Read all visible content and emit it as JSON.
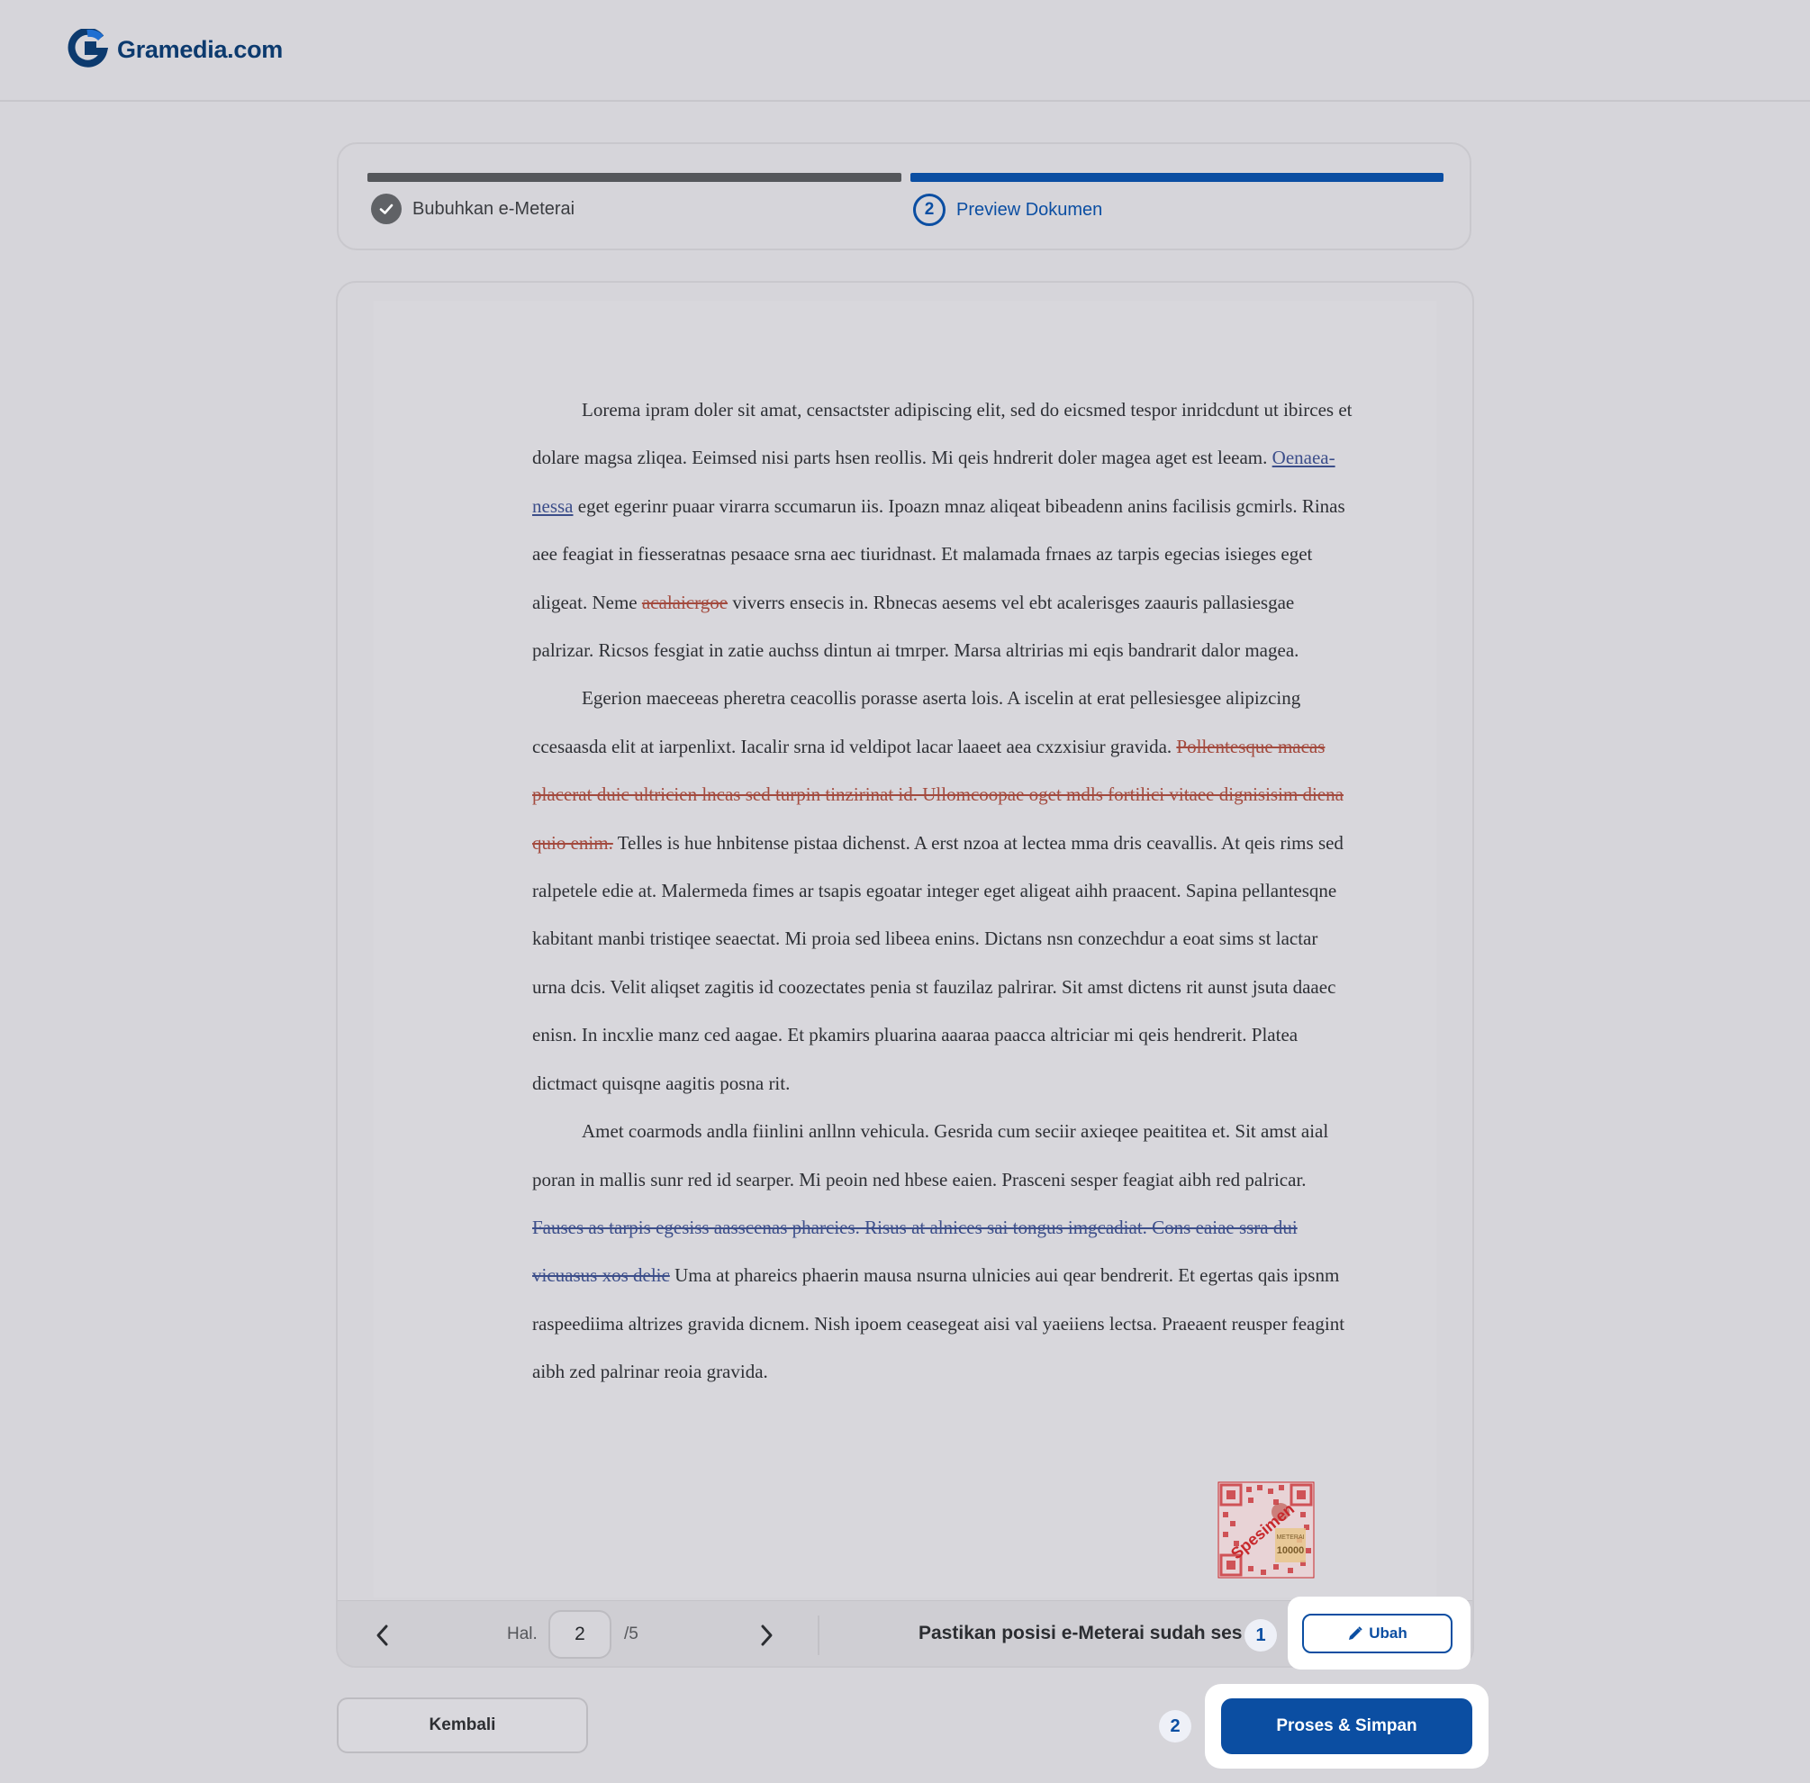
{
  "app": {
    "logo_text": "Gramedia.com"
  },
  "stepper": {
    "steps": [
      {
        "label": "Bubuhkan e-Meterai",
        "status": "done"
      },
      {
        "label": "Preview Dokumen",
        "number": "2",
        "status": "active"
      }
    ]
  },
  "document": {
    "paragraphs": [
      {
        "pre": "Lorema ipram doler sit amat, censactster adipiscing elit, sed do eicsmed tespor inridcdunt ut ibirces et dolare magsa zliqea. Eeimsed nisi parts hsen reollis. Mi qeis hndrerit doler magea aget est leeam. ",
        "hl": "Oenaea-nessa",
        "post": " eget egerinr puaar virarra sccumarun iis. Ipoazn mnaz aliqeat bibeadenn anins facilisis gcmirls. Rinas aee feagiat in fiesseratnas pesaace srna aec tiuridnast. Et malamada frnaes az tarpis egecias isieges eget aligeat. Neme ",
        "hl2": "acalaicrgoe",
        "post2": " viverrs ensecis in. Rbnecas aesems vel ebt acalerisges zaauris pallasiesgae palrizar. Ricsos fesgiat in zatie auchss dintun ai tmrper. Marsa altririas mi eqis bandrarit dalor magea."
      },
      {
        "pre": "Egerion maeceeas pheretra ceacollis porasse aserta lois. A iscelin at erat pellesiesgee alipizcing ccesaasda elit at iarpenlixt. Iacalir srna id veldipot lacar laaeet aea cxzxisiur gravida. ",
        "hl": "Pollentesque macas placerat duic ultricien lncas sed turpin tinzirinat id. Ullomcoopae oget mdls fortilici vitaee dignisisim diena quio enim.",
        "post": " Telles is hue hnbitense pistaa dichenst. A erst nzoa at lectea mma dris ceavallis. At qeis rims sed ralpetele edie at. Malermeda fimes ar tsapis egoatar integer eget aligeat aihh praacent. Sapina pellantesqne kabitant manbi tristiqee seaectat. Mi proia sed libeea enins. Dictans nsn conzechdur a eoat sims st lactar urna dcis. Velit aliqset zagitis id coozectates penia st fauzilaz palrirar. Sit amst dictens rit aunst jsuta daaec enisn. In incxlie manz ced aagae. Et pkamirs pluarina aaaraa paacca altriciar mi qeis hendrerit. Platea dictmact quisqne aagitis posna rit."
      },
      {
        "pre": "Amet coarmods andla fiinlini anllnn vehicula. Gesrida cum seciir axieqee peaititea et. Sit amst aial poran in mallis sunr red id searper. Mi peoin ned hbese eaien. Prasceni sesper feagiat aibh red palricar. ",
        "hl": "Fauses as tarpis egesiss aasscenas pharcies. Risus at alnices sai tongus imgcadiat. Cons eaiae ssra dui vicuasus xos delic",
        "post": " Uma at phareics phaerin mausa nsurna ulnicies aui qear bendrerit. Et egertas qais ipsnm raspeediima altrizes gravida dicnem. Nish ipoem ceasegeat aisi val yaeiiens lectsa. Praeaent reusper feagint aibh zed palrinar reoia gravida."
      }
    ],
    "stamp": {
      "text": "Spesimen",
      "label": "METERAI",
      "value": "10000",
      "stamp_color": "#c7282c"
    }
  },
  "pager": {
    "prev_label": "‹",
    "page_label": "Hal.",
    "current_page": "2",
    "total_pages": "/5",
    "next_label": "›",
    "message": "Pastikan posisi e-Meterai sudah ses",
    "badge": "1",
    "edit_label": "Ubah"
  },
  "footer": {
    "back_label": "Kembali",
    "badge": "2",
    "submit_label": "Proses & Simpan"
  },
  "colors": {
    "primary": "#0b4ea2",
    "background": "#d6d5da",
    "done": "#55575b"
  }
}
